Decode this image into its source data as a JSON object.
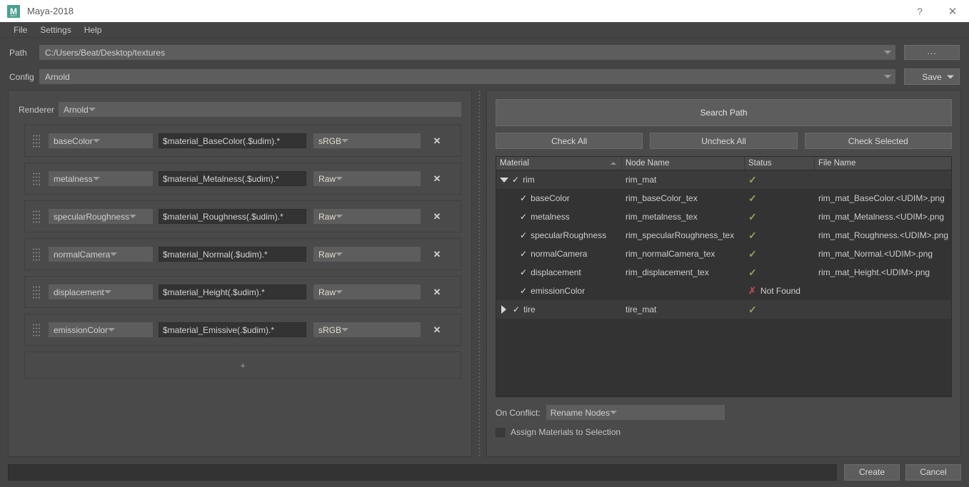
{
  "window": {
    "title": "Maya-2018",
    "logo_letter": "M",
    "logo_sub": "MAYA",
    "logo_color": "#4aa08e",
    "help_icon": "?",
    "close_icon": "✕"
  },
  "menubar": {
    "items": [
      {
        "label": "File"
      },
      {
        "label": "Settings"
      },
      {
        "label": "Help"
      }
    ]
  },
  "top": {
    "path_label": "Path",
    "path_value": "C:/Users/Beat/Desktop/textures",
    "browse_label": "...",
    "config_label": "Config",
    "config_value": "Arnold",
    "save_label": "Save"
  },
  "left_panel": {
    "renderer_label": "Renderer",
    "renderer_value": "Arnold",
    "add_row_label": "+",
    "remove_icon": "✕",
    "channels": [
      {
        "channel": "baseColor",
        "pattern": "$material_BaseColor(.$udim).*",
        "colorspace": "sRGB"
      },
      {
        "channel": "metalness",
        "pattern": "$material_Metalness(.$udim).*",
        "colorspace": "Raw"
      },
      {
        "channel": "specularRoughness",
        "pattern": "$material_Roughness(.$udim).*",
        "colorspace": "Raw"
      },
      {
        "channel": "normalCamera",
        "pattern": "$material_Normal(.$udim).*",
        "colorspace": "Raw"
      },
      {
        "channel": "displacement",
        "pattern": "$material_Height(.$udim).*",
        "colorspace": "Raw"
      },
      {
        "channel": "emissionColor",
        "pattern": "$material_Emissive(.$udim).*",
        "colorspace": "sRGB"
      }
    ]
  },
  "right_panel": {
    "search_path_label": "Search Path",
    "check_all_label": "Check All",
    "uncheck_all_label": "Uncheck All",
    "check_selected_label": "Check Selected",
    "columns": [
      {
        "label": "Material"
      },
      {
        "label": "Node Name"
      },
      {
        "label": "Status"
      },
      {
        "label": "File Name"
      }
    ],
    "sort_column": "Material",
    "sort_direction": "ascending",
    "ok_glyph": "✓",
    "bad_glyph": "✗",
    "checked_glyph": "✓",
    "rows": [
      {
        "level": 0,
        "expanded": true,
        "checked": true,
        "material": "rim",
        "node_name": "rim_mat",
        "status": "ok",
        "status_text": "",
        "file_name": ""
      },
      {
        "level": 1,
        "expanded": null,
        "checked": true,
        "material": "baseColor",
        "node_name": "rim_baseColor_tex",
        "status": "ok",
        "status_text": "",
        "file_name": "rim_mat_BaseColor.<UDIM>.png"
      },
      {
        "level": 1,
        "expanded": null,
        "checked": true,
        "material": "metalness",
        "node_name": "rim_metalness_tex",
        "status": "ok",
        "status_text": "",
        "file_name": "rim_mat_Metalness.<UDIM>.png"
      },
      {
        "level": 1,
        "expanded": null,
        "checked": true,
        "material": "specularRoughness",
        "node_name": "rim_specularRoughness_tex",
        "status": "ok",
        "status_text": "",
        "file_name": "rim_mat_Roughness.<UDIM>.png"
      },
      {
        "level": 1,
        "expanded": null,
        "checked": true,
        "material": "normalCamera",
        "node_name": "rim_normalCamera_tex",
        "status": "ok",
        "status_text": "",
        "file_name": "rim_mat_Normal.<UDIM>.png"
      },
      {
        "level": 1,
        "expanded": null,
        "checked": true,
        "material": "displacement",
        "node_name": "rim_displacement_tex",
        "status": "ok",
        "status_text": "",
        "file_name": "rim_mat_Height.<UDIM>.png"
      },
      {
        "level": 1,
        "expanded": null,
        "checked": true,
        "material": "emissionColor",
        "node_name": "",
        "status": "bad",
        "status_text": "Not Found",
        "file_name": ""
      },
      {
        "level": 0,
        "expanded": false,
        "checked": true,
        "material": "tire",
        "node_name": "tire_mat",
        "status": "ok",
        "status_text": "",
        "file_name": ""
      }
    ],
    "on_conflict_label": "On Conflict:",
    "on_conflict_value": "Rename Nodes",
    "assign_label": "Assign Materials to Selection",
    "assign_checked": false
  },
  "footer": {
    "create_label": "Create",
    "cancel_label": "Cancel"
  },
  "colors": {
    "status_ok": "#8fa55a",
    "status_bad": "#b04a52",
    "accent_logo": "#4aa08e",
    "panel_bg": "#4a4a4a",
    "window_bg": "#444444",
    "field_bg": "#333333",
    "control_bg": "#5d5d5d"
  }
}
